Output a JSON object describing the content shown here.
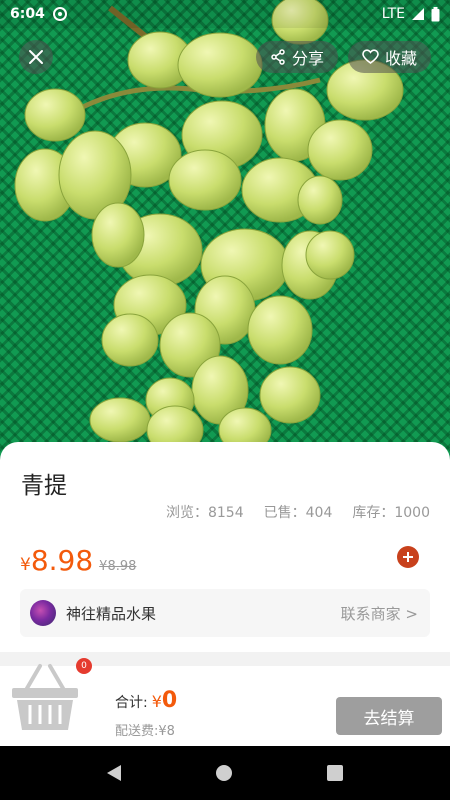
{
  "status_bar": {
    "time": "6:04",
    "network": "LTE"
  },
  "header": {
    "share_label": "分享",
    "favorite_label": "收藏"
  },
  "product": {
    "title": "青提",
    "stats": {
      "views": "浏览：8154",
      "sold": "已售：404",
      "stock": "库存：1000"
    },
    "price_symbol": "¥",
    "price": "8.98",
    "original_price": "¥8.98"
  },
  "shop": {
    "name": "神往精品水果",
    "contact_label": "联系商家 >"
  },
  "cart": {
    "badge_count": "0",
    "total_label": "合计:",
    "total_symbol": "¥",
    "total_value": "0",
    "delivery_fee": "配送费:¥8",
    "checkout_label": "去结算"
  },
  "colors": {
    "accent": "#f35a0c",
    "add_button": "#c8411c",
    "checkout_disabled": "#9e9e9e",
    "mat_green": "#119a52"
  },
  "icons": [
    "close-icon",
    "share-icon",
    "heart-icon",
    "plus-icon",
    "basket-icon",
    "nav-back-icon",
    "nav-home-icon",
    "nav-recent-icon"
  ]
}
